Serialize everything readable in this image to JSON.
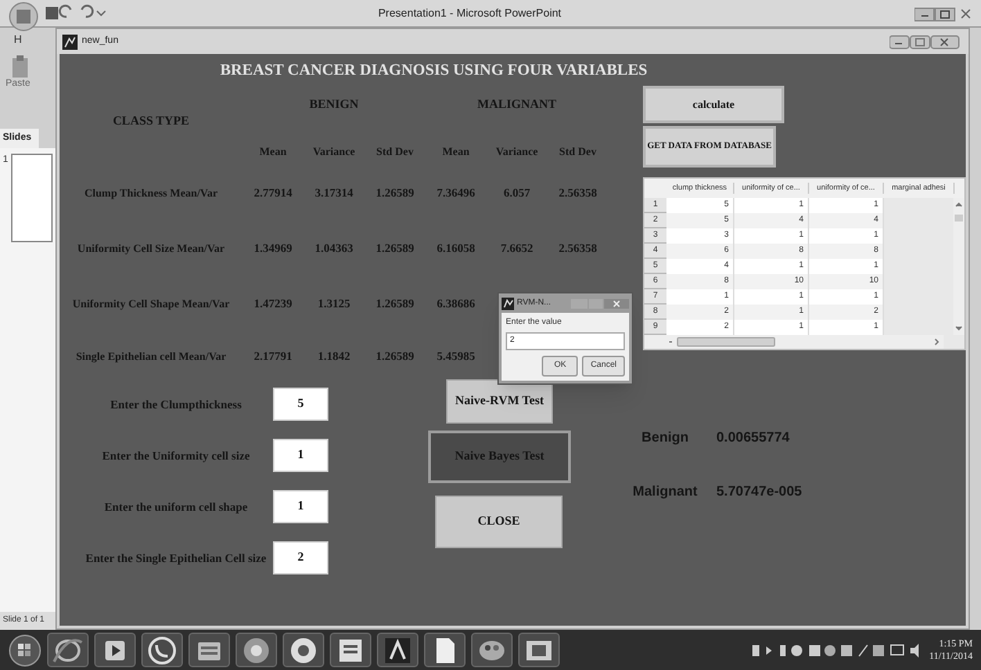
{
  "app_window": {
    "title": "Presentation1 - Microsoft PowerPoint",
    "ribbon_tab": "H",
    "paste_label": "Paste",
    "pane_tab": "Slides",
    "slide_number": "1",
    "status": "Slide 1 of 1"
  },
  "figure": {
    "title": "new_fun",
    "heading": "BREAST CANCER DIAGNOSIS USING FOUR VARIABLES",
    "class_type_label": "CLASS TYPE",
    "groups": [
      "BENIGN",
      "MALIGNANT"
    ],
    "columns": [
      "Mean",
      "Variance",
      "Std Dev",
      "Mean",
      "Variance",
      "Std Dev"
    ],
    "rows": [
      {
        "label": "Clump Thickness Mean/Var",
        "values": [
          "2.77914",
          "3.17314",
          "1.26589",
          "7.36496",
          "6.057",
          "2.56358"
        ]
      },
      {
        "label": "Uniformity Cell Size Mean/Var",
        "values": [
          "1.34969",
          "1.04363",
          "1.26589",
          "6.16058",
          "7.6652",
          "2.56358"
        ]
      },
      {
        "label": "Uniformity Cell Shape Mean/Var",
        "values": [
          "1.47239",
          "1.3125",
          "1.26589",
          "6.38686"
        ]
      },
      {
        "label": "Single Epithelian cell Mean/Var",
        "values": [
          "2.17791",
          "1.1842",
          "1.26589",
          "5.45985"
        ]
      }
    ],
    "inputs": [
      {
        "label": "Enter the Clumpthickness",
        "value": "5"
      },
      {
        "label": "Enter the Uniformity cell size",
        "value": "1"
      },
      {
        "label": "Enter the uniform cell shape",
        "value": "1"
      },
      {
        "label": "Enter the Single Epithelian Cell size",
        "value": "2"
      }
    ],
    "action_buttons": [
      {
        "label": "Naive-RVM Test",
        "pressed": false
      },
      {
        "label": "Naive Bayes Test",
        "pressed": true
      },
      {
        "label": "CLOSE",
        "pressed": false
      }
    ],
    "results": [
      {
        "label": "Benign",
        "value": "0.00655774"
      },
      {
        "label": "Malignant",
        "value": "5.70747e-005"
      }
    ],
    "calculate_button": "calculate",
    "database_button": "GET DATA FROM DATABASE",
    "data_table": {
      "columns": [
        "clump thickness",
        "uniformity of ce...",
        "uniformity of ce...",
        "marginal adhesi"
      ],
      "rows": [
        {
          "index": "1",
          "cells": [
            "5",
            "1",
            "1"
          ]
        },
        {
          "index": "2",
          "cells": [
            "5",
            "4",
            "4"
          ]
        },
        {
          "index": "3",
          "cells": [
            "3",
            "1",
            "1"
          ]
        },
        {
          "index": "4",
          "cells": [
            "6",
            "8",
            "8"
          ]
        },
        {
          "index": "5",
          "cells": [
            "4",
            "1",
            "1"
          ]
        },
        {
          "index": "6",
          "cells": [
            "8",
            "10",
            "10"
          ]
        },
        {
          "index": "7",
          "cells": [
            "1",
            "1",
            "1"
          ]
        },
        {
          "index": "8",
          "cells": [
            "2",
            "1",
            "2"
          ]
        },
        {
          "index": "9",
          "cells": [
            "2",
            "1",
            "1"
          ]
        }
      ]
    },
    "dialog": {
      "title": "RVM-N...",
      "prompt": "Enter the value",
      "value": "2",
      "buttons": [
        "OK",
        "Cancel"
      ]
    }
  },
  "taskbar": {
    "time": "1:15 PM",
    "date": "11/11/2014"
  }
}
